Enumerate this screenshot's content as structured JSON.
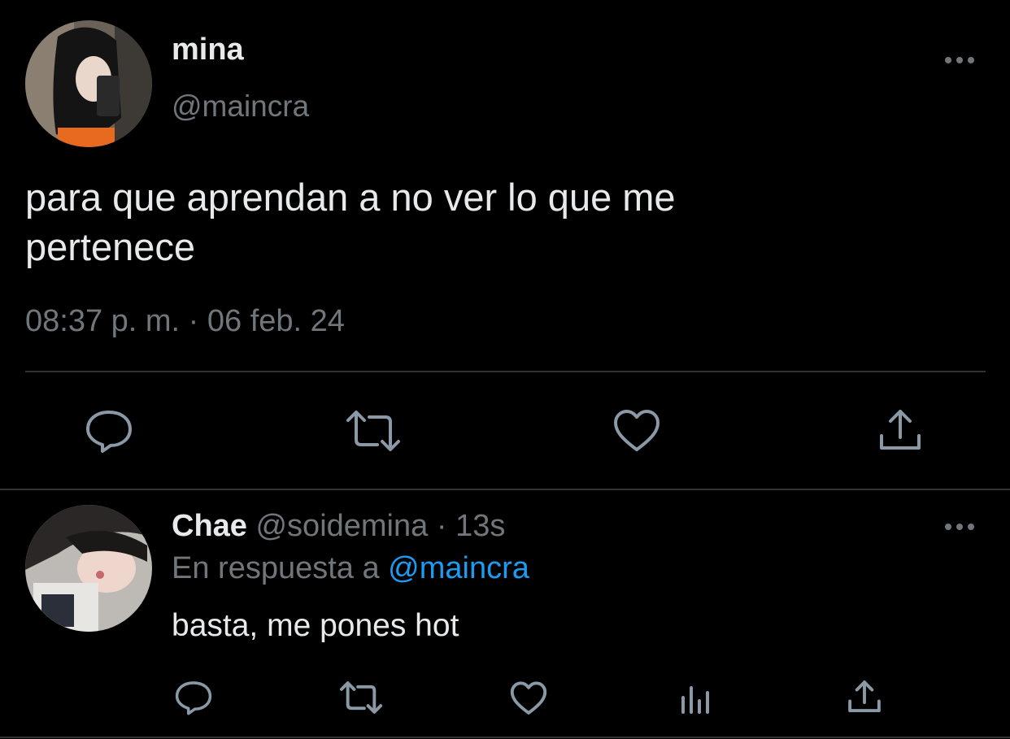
{
  "main_tweet": {
    "display_name": "mina",
    "handle": "@maincra",
    "text_line1": "para que aprendan a no ver lo que me",
    "text_line2": "pertenece",
    "timestamp": "08:37 p. m. · 06 feb. 24",
    "actions": [
      "reply-icon",
      "retweet-icon",
      "like-icon",
      "share-icon"
    ]
  },
  "reply": {
    "display_name": "Chae",
    "handle": "@soidemina",
    "separator": "·",
    "time": "13s",
    "reply_prefix": "En respuesta a",
    "reply_to": "@maincra",
    "text": "basta, me pones hot",
    "actions": [
      "reply-icon",
      "retweet-icon",
      "like-icon",
      "analytics-icon",
      "share-icon"
    ]
  },
  "colors": {
    "background": "#000000",
    "text": "#e7e9ea",
    "muted": "#71767b",
    "link": "#1d9bf0",
    "divider": "#2f3336"
  }
}
